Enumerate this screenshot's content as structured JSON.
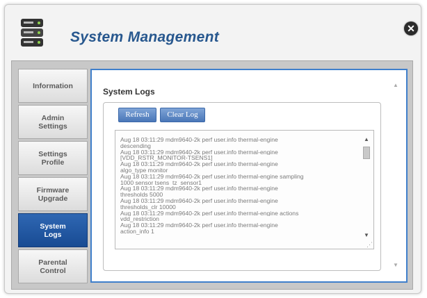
{
  "header": {
    "title": "System Management",
    "close_label": "✕",
    "icon": "database-icon"
  },
  "sidebar": {
    "items": [
      {
        "label": "Information",
        "active": false
      },
      {
        "label": "Admin\nSettings",
        "active": false
      },
      {
        "label": "Settings\nProfile",
        "active": false
      },
      {
        "label": "Firmware\nUpgrade",
        "active": false
      },
      {
        "label": "System\nLogs",
        "active": true
      },
      {
        "label": "Parental\nControl",
        "active": false
      }
    ]
  },
  "main": {
    "section_title": "System Logs",
    "refresh_label": "Refresh",
    "clear_label": "Clear Log",
    "log_lines": [
      "Aug 18 03:11:29 mdm9640-2k perf user.info thermal-engine",
      "descending",
      "Aug 18 03:11:29 mdm9640-2k perf user.info thermal-engine",
      "[VDD_RSTR_MONITOR-TSENS1]",
      "Aug 18 03:11:29 mdm9640-2k perf user.info thermal-engine",
      "algo_type monitor",
      "Aug 18 03:11:29 mdm9640-2k perf user.info thermal-engine  sampling",
      "1000 sensor tsens_tz_sensor1",
      "Aug 18 03:11:29 mdm9640-2k perf user.info thermal-engine",
      "thresholds 5000",
      "Aug 18 03:11:29 mdm9640-2k perf user.info thermal-engine",
      "thresholds_clr 10000",
      "Aug 18 03:11:29 mdm9640-2k perf user.info thermal-engine  actions",
      "vdd_restriction",
      "Aug 18 03:11:29 mdm9640-2k perf user.info thermal-engine",
      "action_info 1"
    ]
  },
  "colors": {
    "title": "#27578e",
    "active_nav": "#184b93",
    "panel_border": "#3f7fcb"
  }
}
